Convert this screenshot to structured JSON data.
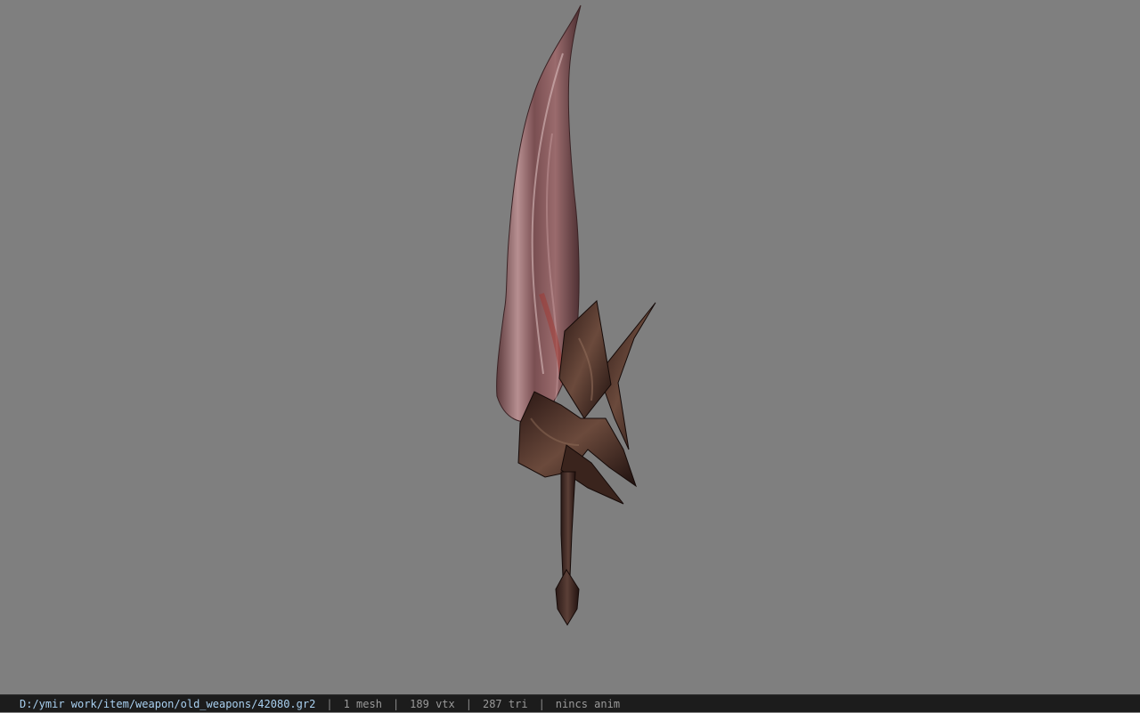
{
  "status_bar": {
    "file_path": "D:/ymir work/item/weapon/old_weapons/42080.gr2",
    "separator": "|",
    "mesh_count": "1 mesh",
    "vertex_count": "189 vtx",
    "triangle_count": "287 tri",
    "animation_status": "nincs anim"
  },
  "colors": {
    "viewport_background": "#7f7f7f",
    "status_background": "#1c1c1c",
    "path_text": "#a9d0f0",
    "info_text": "#9a9a9a"
  }
}
